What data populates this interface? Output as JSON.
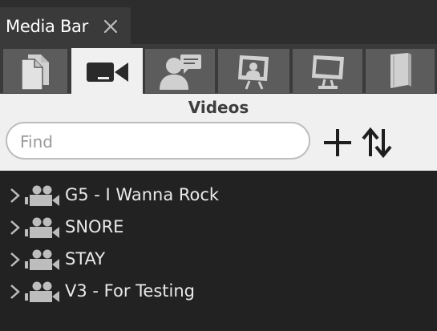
{
  "window": {
    "tab_title": "Media Bar"
  },
  "media_tabs": [
    {
      "icon": "documents-icon",
      "active": false
    },
    {
      "icon": "video-camera-icon",
      "active": true
    },
    {
      "icon": "presenter-icon",
      "active": false
    },
    {
      "icon": "stage-display-icon",
      "active": false
    },
    {
      "icon": "monitor-icon",
      "active": false
    },
    {
      "icon": "book-icon",
      "active": false
    }
  ],
  "panel": {
    "title": "Videos",
    "find_placeholder": "Find"
  },
  "videos": [
    {
      "label": "G5 - I Wanna Rock"
    },
    {
      "label": "SNORE"
    },
    {
      "label": "STAY"
    },
    {
      "label": "V3 - For Testing"
    }
  ],
  "colors": {
    "background": "#222222",
    "tab_inactive": "#5c5c5c",
    "tab_active": "#f0f0f0",
    "icon_dark": "#2a2a2a",
    "icon_light": "#d0d0d0",
    "text_light": "#eaeaea"
  }
}
